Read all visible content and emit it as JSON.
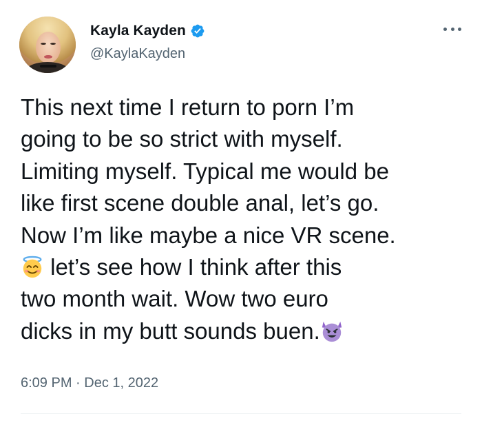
{
  "author": {
    "display_name": "Kayla Kayden",
    "handle": "@KaylaKayden",
    "verified": true,
    "avatar_alt": "avatar"
  },
  "tweet": {
    "lines": [
      "This next time I return to porn I’m",
      "going to be so strict with myself.",
      "Limiting myself. Typical me would be",
      "like first scene double anal, let’s go.",
      "Now I’m like maybe a nice VR scene.",
      " let’s see how I think after this",
      "two month wait. Wow two euro",
      "dicks in my butt sounds buen."
    ],
    "emojis": [
      "smiling-face-with-halo-emoji",
      "smiling-face-with-horns-emoji"
    ]
  },
  "meta": {
    "time": "6:09 PM",
    "separator": " · ",
    "date": "Dec 1, 2022"
  },
  "colors": {
    "text": "#0f1419",
    "secondary": "#536471",
    "verified_blue": "#1d9bf0",
    "divider": "#eff3f4"
  },
  "icons": {
    "more": "more-options-icon",
    "verified": "verified-badge-icon"
  }
}
